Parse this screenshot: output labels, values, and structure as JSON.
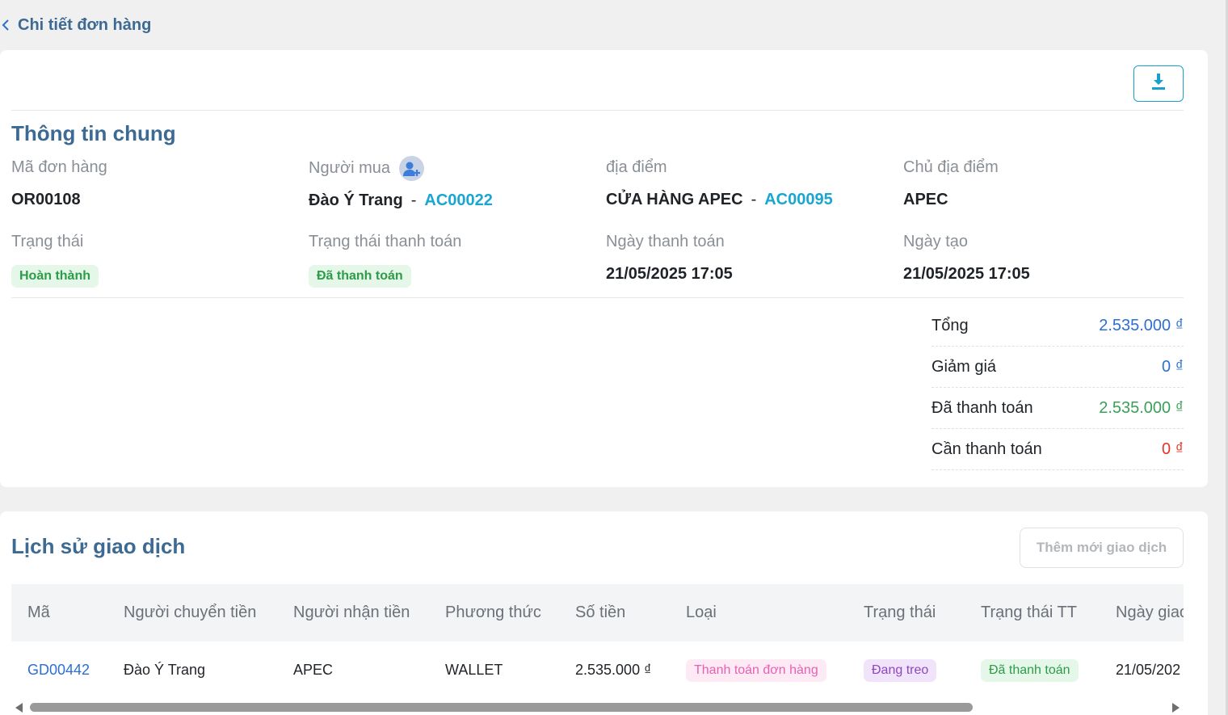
{
  "header": {
    "title": "Chi tiết đơn hàng"
  },
  "general": {
    "title": "Thông tin chung",
    "order_code_label": "Mã đơn hàng",
    "order_code": "OR00108",
    "buyer_label": "Người mua",
    "buyer_name": "Đào Ý Trang",
    "buyer_code": "AC00022",
    "location_label": "địa điểm",
    "location_name": "CỬA HÀNG APEC",
    "location_code": "AC00095",
    "owner_label": "Chủ địa điểm",
    "owner": "APEC",
    "status_label": "Trạng thái",
    "status": "Hoàn thành",
    "payment_status_label": "Trạng thái thanh toán",
    "payment_status": "Đã thanh toán",
    "payment_date_label": "Ngày thanh toán",
    "payment_date": "21/05/2025 17:05",
    "created_label": "Ngày tạo",
    "created_date": "21/05/2025 17:05",
    "separator": "-"
  },
  "summary": {
    "total_label": "Tổng",
    "total": "2.535.000 ₫",
    "discount_label": "Giảm giá",
    "discount": "0 ₫",
    "paid_label": "Đã thanh toán",
    "paid": "2.535.000 ₫",
    "due_label": "Cần thanh toán",
    "due": "0 ₫"
  },
  "transactions": {
    "title": "Lịch sử giao dịch",
    "add_button": "Thêm mới giao dịch",
    "columns": [
      "Mã",
      "Người chuyển tiền",
      "Người nhận tiền",
      "Phương thức",
      "Số tiền",
      "Loại",
      "Trạng thái",
      "Trạng thái TT",
      "Ngày giao"
    ],
    "rows": [
      {
        "code": "GD00442",
        "sender": "Đào Ý Trang",
        "receiver": "APEC",
        "method": "WALLET",
        "amount": "2.535.000 ₫",
        "type": "Thanh toán đơn hàng",
        "status": "Đang treo",
        "payment_status": "Đã thanh toán",
        "date": "21/05/202"
      }
    ]
  },
  "colors": {
    "accent": "#3d6a93",
    "link": "#19a6d1",
    "blue": "#2c6fd1",
    "green": "#3aa057",
    "red": "#e2342a"
  },
  "icons": {
    "back": "chevron-left-icon",
    "download": "download-icon",
    "add_user": "user-add-icon"
  }
}
